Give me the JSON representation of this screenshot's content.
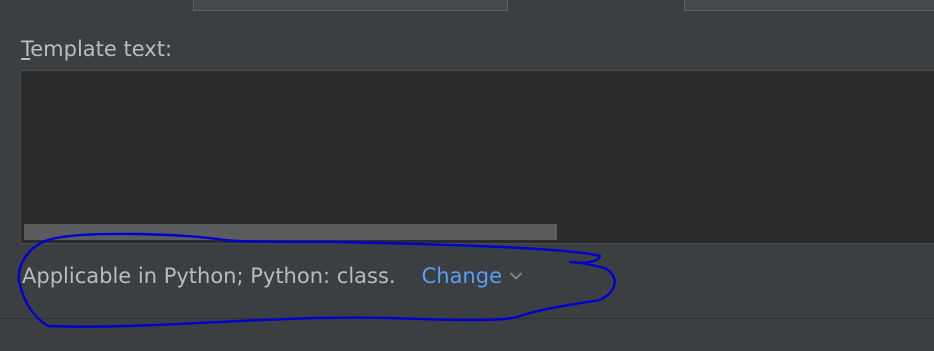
{
  "template_text": {
    "label_mnemonic": "T",
    "label_rest": "emplate text:",
    "value": ""
  },
  "context": {
    "applicable_text": "Applicable in Python; Python: class.",
    "change_link_label": "Change"
  },
  "annotation_color": "#0000d0"
}
